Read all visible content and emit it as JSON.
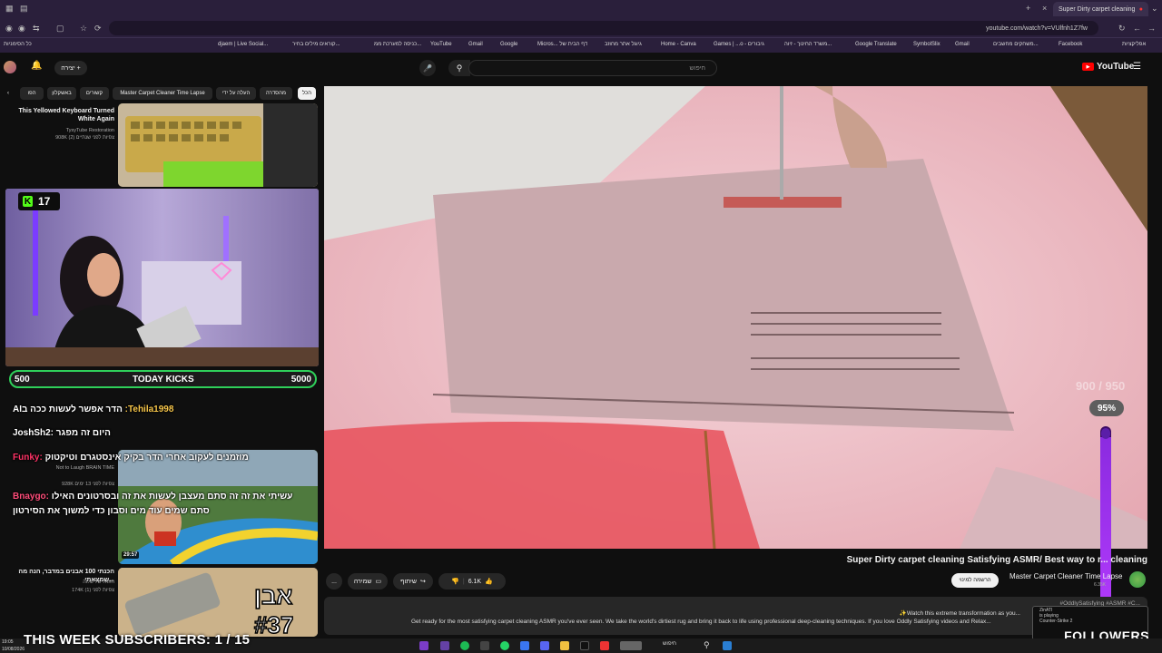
{
  "browser": {
    "tab_title": "Super Dirty carpet cleaning",
    "url": "youtube.com/watch?v=VUlfnh1Z7fw",
    "bookmarks": [
      "djaem | Live Social...",
      "קוראים מילים בחיר...",
      "כניסה למערכת ממ...",
      "YouTube",
      "Gmail",
      "Google",
      "Micros... דף הבית של",
      "גיוגל אתר מחוזב",
      "Home - Canva",
      "Games | ...o - גיבורים",
      "משרד החינוך - זיוה...",
      "Google Translate",
      "SymbolSlix",
      "Gmail",
      "משחקים מחשבים...",
      "Facebook",
      "אפליקציות",
      "כל הסימניות"
    ]
  },
  "youtube": {
    "logo_text": "YouTube",
    "search_placeholder": "חיפוש",
    "create_label": "יצירה",
    "chips": [
      "הכל",
      "מהסדרה",
      "העלה על ידי",
      "Master Carpet Cleaner Time Lapse",
      "קשורים",
      "באשקלון",
      "הפו"
    ],
    "video_title": "Super Dirty carpet cleaning Satisfying ASMR/ Best way to r... cleaning",
    "channel_name": "Master Carpet Cleaner Time Lapse",
    "channel_subs": "6.35K",
    "subscribe_label": "הרשמה למינוי",
    "like_count": "6.1K",
    "share_label": "שיתוף",
    "save_label": "שמירה",
    "more_label": "...",
    "description_tags": "#OddlySatisfying #ASMR #C...",
    "description_line1": "✨Watch this extreme transformation as you...",
    "description_line2": "Get ready for the most satisfying carpet cleaning ASMR you've ever seen. We take the world's dirtiest rug and bring it back to life using professional deep-cleaning techniques. If you love Oddly Satisfying videos and Relax..."
  },
  "recommendations": [
    {
      "title": "This Yellowed Keyboard Turned White Again",
      "channel": "TysyTube Restoration",
      "meta": "908K צפיות לפני שנתיים (2)"
    },
    {
      "title": "מוזמנים לעקוב אחרי הדר בקיק אינסטגרם וטיקטוק",
      "channel": "Not to Laugh BRAIN TIME",
      "meta": "928K צפיות לפני 13 ימים",
      "duration": "29:57"
    },
    {
      "title": "הכנתי 100 אבנים במדבר, הנה מה שמצאתי...",
      "channel": "הוזאל של שלוה",
      "meta": "174K צפיות לפני (1)",
      "extra": "אבן #37"
    }
  ],
  "overlay": {
    "kick_count": "17",
    "today_kicks_label": "TODAY KICKS",
    "kicks_min": "500",
    "kicks_max": "5000",
    "goal_count": "900 / 950",
    "goal_percent": "95%",
    "goal_fraction": 0.95,
    "sub_goal": "THIS WEEK SUBSCRIBERS: 1 / 15",
    "followers_label": "FOLLOWERS",
    "ingame": [
      "ZinATI",
      "is playing",
      "Counter-Strike 2"
    ]
  },
  "chat": [
    {
      "user": "Tehila1998:",
      "text": "הדר אפשר לעשות ככה בAI"
    },
    {
      "user": "JoshSh2:",
      "text": "היום זה מפגר"
    },
    {
      "user": "Funky:",
      "text": "מוזמנים לעקוב אחרי הדר בקיק אינסטגרם וטיקטוק"
    },
    {
      "user": "Bnaygo:",
      "text": "עשיתי את זה זה סתם מעצבן לעשות את זה ובסרטונים האילו סתם שמים עוד מים וסבון כדי למשוך את הסירטון"
    }
  ],
  "taskbar": {
    "time": "19:05",
    "date": "10/08/2026",
    "search_label": "חיפוש"
  },
  "colors": {
    "accent_green": "#53fc18",
    "username": "#f7c64a",
    "bar_purple": "#b63cff"
  }
}
